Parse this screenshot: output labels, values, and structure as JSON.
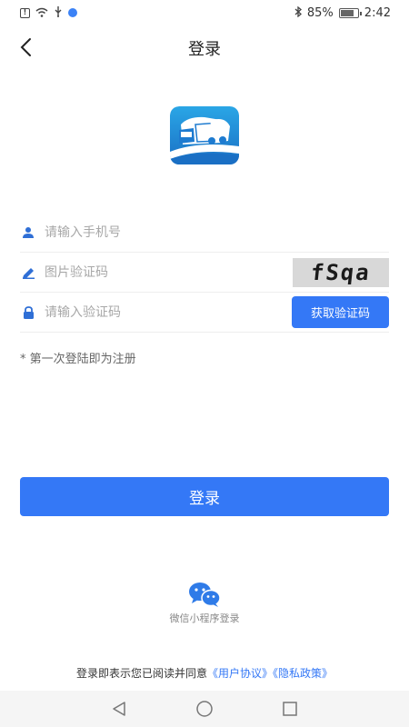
{
  "status_bar": {
    "left_icons": [
      "sim-alert-icon",
      "wifi-icon",
      "usb-icon",
      "app-notification-icon"
    ],
    "bluetooth_icon": "bluetooth-icon",
    "battery_percent_text": "85%",
    "battery_level": 0.85,
    "time": "2:42"
  },
  "header": {
    "back_icon": "chevron-left-icon",
    "title": "登录"
  },
  "logo": {
    "icon": "truck-logo-icon",
    "colors": {
      "top": "#2196d8",
      "bottom": "#1e74c8",
      "road": "#ffffff"
    }
  },
  "form": {
    "phone": {
      "icon": "user-icon",
      "placeholder": "请输入手机号",
      "value": ""
    },
    "captcha": {
      "icon": "pencil-icon",
      "placeholder": "图片验证码",
      "value": "",
      "image_text": "fSqa"
    },
    "sms_code": {
      "icon": "lock-icon",
      "placeholder": "请输入验证码",
      "value": "",
      "button_label": "获取验证码"
    }
  },
  "hint": "* 第一次登陆即为注册",
  "login_button": "登录",
  "wechat": {
    "icon": "wechat-icon",
    "label": "微信小程序登录"
  },
  "agreement": {
    "prefix": "登录即表示您已阅读并同意",
    "user_agreement": "《用户协议》",
    "privacy_policy": "《隐私政策》"
  },
  "system_nav": {
    "back": "triangle-back-icon",
    "home": "circle-home-icon",
    "recents": "square-recents-icon"
  },
  "colors": {
    "accent": "#3478f6",
    "icon_blue": "#2f6fd6",
    "divider": "#eeeeee"
  }
}
